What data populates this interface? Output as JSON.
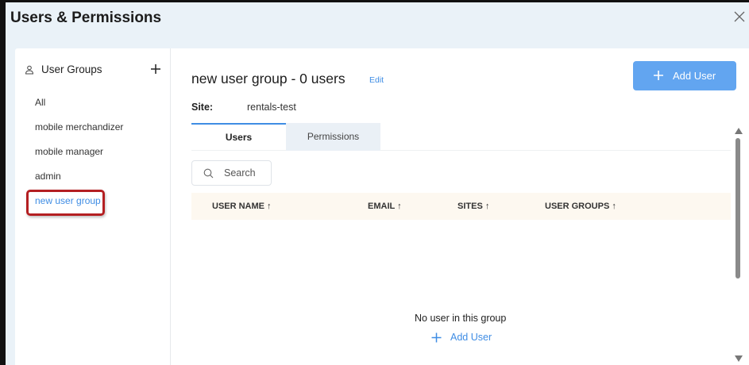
{
  "window": {
    "title": "Users & Permissions",
    "close_icon": "close-icon"
  },
  "sidebar": {
    "header": "User Groups",
    "header_icon": "person-icon",
    "add_icon": "plus-icon",
    "items": [
      {
        "label": "All"
      },
      {
        "label": "mobile merchandizer"
      },
      {
        "label": "mobile manager"
      },
      {
        "label": "admin"
      },
      {
        "label": "new user group",
        "selected": true
      }
    ]
  },
  "main": {
    "group_title": "new user group - 0 users",
    "edit_label": "Edit",
    "add_user_button": "Add User",
    "site_label": "Site:",
    "site_value": "rentals-test",
    "tabs": [
      {
        "label": "Users",
        "active": true
      },
      {
        "label": "Permissions",
        "active": false
      }
    ],
    "search_placeholder": "Search",
    "columns": [
      "USER NAME ↑",
      "EMAIL ↑",
      "SITES ↑",
      "USER GROUPS ↑"
    ],
    "rows": [],
    "empty_message": "No user in this group",
    "empty_add_label": "Add User"
  },
  "colors": {
    "accent": "#3f8de4",
    "button": "#62a5f0",
    "highlight_border": "#b41f22",
    "background": "#eaf2f8"
  }
}
